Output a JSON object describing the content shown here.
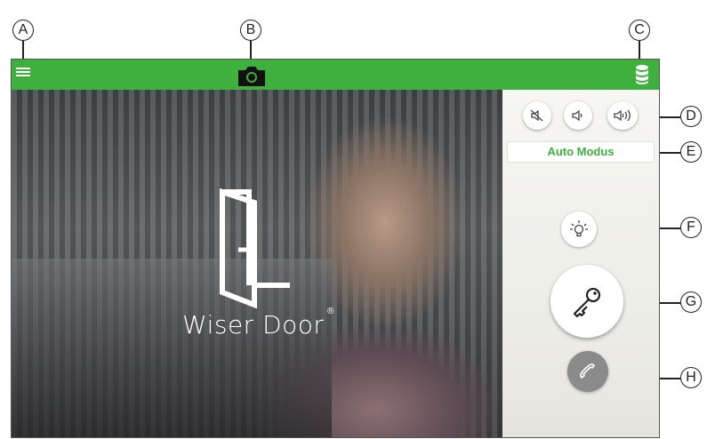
{
  "callouts": {
    "a": "A",
    "b": "B",
    "c": "C",
    "d": "D",
    "e": "E",
    "f": "F",
    "g": "G",
    "h": "H"
  },
  "topbar": {
    "color": "#3db13b",
    "menu_icon": "menu-icon",
    "camera_icon": "camera-icon",
    "storage_icon": "storage-icon"
  },
  "video": {
    "logo_icon": "door-logo-icon",
    "brand": "Wiser Door",
    "registered_mark": "®"
  },
  "controls": {
    "mute_icon": "speaker-mute-icon",
    "volume_low_icon": "speaker-low-icon",
    "volume_high_icon": "speaker-high-icon",
    "auto_mode_label": "Auto Modus",
    "light_icon": "light-bulb-icon",
    "door_open_icon": "key-icon",
    "call_icon": "phone-handset-icon"
  }
}
